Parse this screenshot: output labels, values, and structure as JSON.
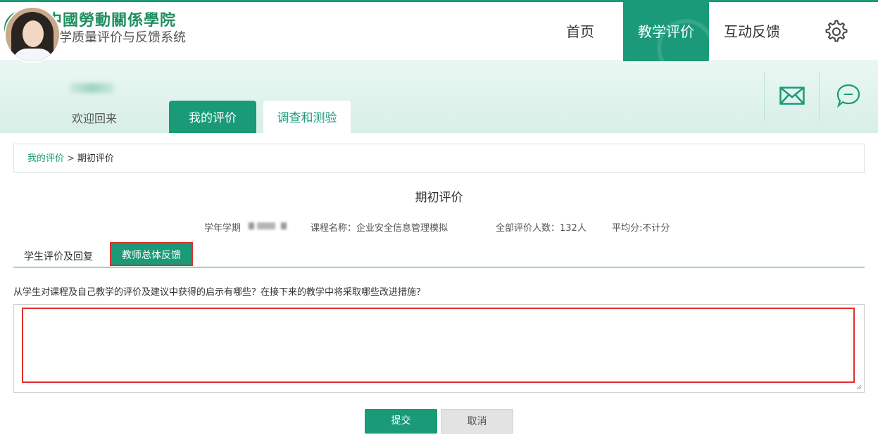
{
  "header": {
    "school_name": "中國勞動關係學院",
    "system_name": "教学质量评价与反馈系统",
    "nav": [
      {
        "label": "首页"
      },
      {
        "label": "教学评价"
      },
      {
        "label": "互动反馈"
      }
    ],
    "settings_icon": "gear-icon"
  },
  "user": {
    "welcome_text": "欢迎回来",
    "tabs": [
      {
        "label": "我的评价"
      },
      {
        "label": "调查和测验"
      }
    ],
    "icons": [
      "mail-icon",
      "chat-bubble-icon"
    ]
  },
  "breadcrumb": {
    "parent": "我的评价",
    "separator": ">",
    "current": "期初评价"
  },
  "page_title": "期初评价",
  "info": {
    "term_label": "学年学期",
    "course_label": "课程名称：企业安全信息管理模拟",
    "evaluators": "全部评价人数：132人",
    "average": "平均分:不计分"
  },
  "subtabs": [
    {
      "label": "学生评价及回复"
    },
    {
      "label": "教师总体反馈"
    }
  ],
  "question": "从学生对课程及自己教学的评价及建议中获得的启示有哪些？在接下来的教学中将采取哪些改进措施？",
  "textarea": {
    "value": "",
    "placeholder": ""
  },
  "buttons": {
    "submit": "提交",
    "cancel": "取消"
  },
  "colors": {
    "primary": "#1a9a78",
    "highlight": "#e0302c"
  }
}
